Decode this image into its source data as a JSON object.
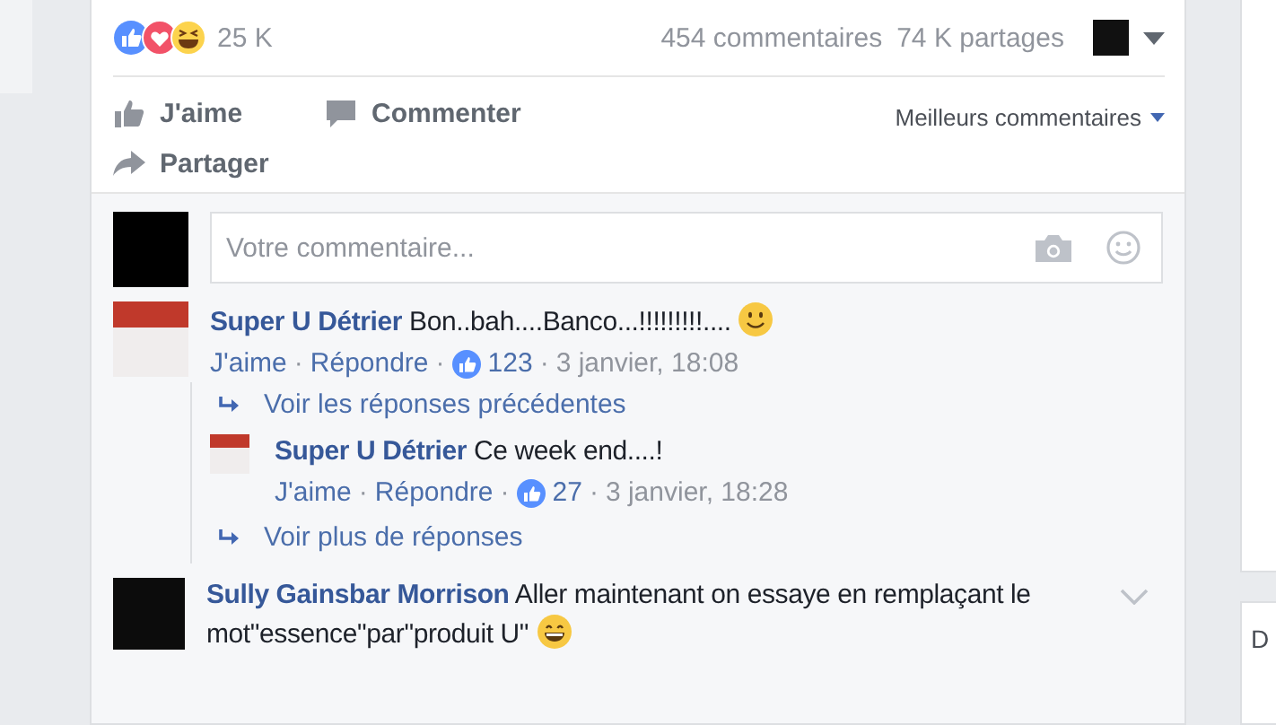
{
  "post": {
    "reaction_count": "25 K",
    "comments_count": "454 commentaires",
    "shares_count": "74 K partages",
    "actions": [
      {
        "kind": "like",
        "label": "J'aime"
      },
      {
        "kind": "comment",
        "label": "Commenter"
      },
      {
        "kind": "share",
        "label": "Partager"
      }
    ],
    "sort": "Meilleurs commentaires"
  },
  "composer": {
    "placeholder": "Votre commentaire..."
  },
  "separator": "·",
  "comments": [
    {
      "author": "Super U Détrier",
      "text": "Bon..bah....Banco...!!!!!!!!!....",
      "emoji": {
        "kind": "smile"
      },
      "avatar": {
        "kind": "poster"
      },
      "like": "J'aime",
      "reply": "Répondre",
      "likes": "123",
      "time": "3 janvier, 18:08",
      "previous_link": "Voir les réponses précédentes",
      "replies": [
        {
          "author": "Super U Détrier",
          "text": "Ce week end....!",
          "avatar": {
            "kind": "poster"
          },
          "like": "J'aime",
          "reply": "Répondre",
          "likes": "27",
          "time": "3 janvier, 18:28"
        }
      ],
      "more_link": "Voir plus de réponses"
    },
    {
      "author": "Sully Gainsbar Morrison",
      "text": "Aller maintenant on essaye en remplaçant le mot\"essence\"par\"produit U\"",
      "emoji": {
        "kind": "grin"
      },
      "avatar": {
        "kind": "dark"
      }
    }
  ],
  "side_panel": {
    "heading": "D"
  }
}
